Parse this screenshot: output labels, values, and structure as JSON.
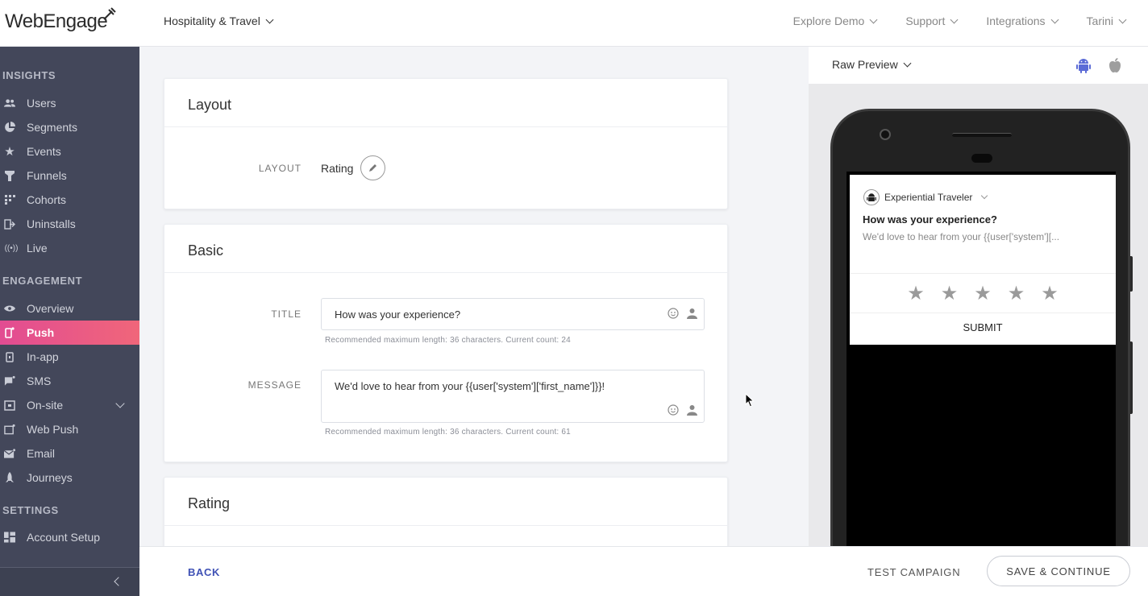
{
  "header": {
    "logo_text": "WebEngage",
    "project": "Hospitality & Travel",
    "nav": [
      "Explore Demo",
      "Support",
      "Integrations",
      "Tarini"
    ]
  },
  "sidebar": {
    "insights_title": "INSIGHTS",
    "insights": [
      {
        "label": "Users",
        "icon": "users-icon"
      },
      {
        "label": "Segments",
        "icon": "pie-icon"
      },
      {
        "label": "Events",
        "icon": "star-icon"
      },
      {
        "label": "Funnels",
        "icon": "funnel-icon"
      },
      {
        "label": "Cohorts",
        "icon": "grid-icon"
      },
      {
        "label": "Uninstalls",
        "icon": "exit-icon"
      },
      {
        "label": "Live",
        "icon": "broadcast-icon"
      }
    ],
    "engagement_title": "ENGAGEMENT",
    "engagement": [
      {
        "label": "Overview",
        "icon": "eye-icon"
      },
      {
        "label": "Push",
        "icon": "mobile-icon"
      },
      {
        "label": "In-app",
        "icon": "tablet-icon"
      },
      {
        "label": "SMS",
        "icon": "sms-icon"
      },
      {
        "label": "On-site",
        "icon": "window-icon"
      },
      {
        "label": "Web Push",
        "icon": "browser-icon"
      },
      {
        "label": "Email",
        "icon": "mail-icon"
      },
      {
        "label": "Journeys",
        "icon": "rocket-icon"
      }
    ],
    "settings_title": "SETTINGS",
    "settings": [
      {
        "label": "Account Setup",
        "icon": "dashboard-icon"
      }
    ]
  },
  "layout_card": {
    "title": "Layout",
    "field_label": "LAYOUT",
    "value": "Rating"
  },
  "basic_card": {
    "title": "Basic",
    "title_label": "TITLE",
    "title_value": "How was your experience?",
    "title_hint": "Recommended maximum length: 36 characters. Current count: 24",
    "message_label": "MESSAGE",
    "message_value": "We'd love to hear from your {{user['system']['first_name']}}!",
    "message_hint": "Recommended maximum length: 36 characters. Current count: 61"
  },
  "rating_card": {
    "title": "Rating"
  },
  "preview": {
    "mode": "Raw Preview",
    "app_name": "Experiential Traveler",
    "notif_title": "How was your experience?",
    "notif_message": "We'd love to hear from your {{user['system'][...",
    "stars": [
      "★",
      "★",
      "★",
      "★",
      "★"
    ],
    "submit": "SUBMIT",
    "android_color": "#5b6bd6",
    "apple_color": "#9e9e9e"
  },
  "footer": {
    "back": "BACK",
    "test": "TEST CAMPAIGN",
    "save": "SAVE & CONTINUE"
  },
  "colors": {
    "sidebar_bg": "#43475a",
    "active_start": "#e24c92",
    "active_end": "#f0667a",
    "link": "#3f51b5"
  }
}
